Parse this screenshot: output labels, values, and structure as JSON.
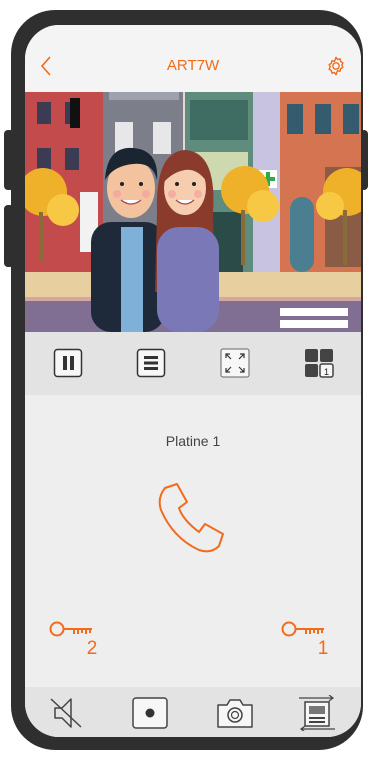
{
  "header": {
    "title": "ART7W",
    "back_icon": "chevron-left-icon",
    "settings_icon": "gear-icon"
  },
  "video": {
    "description_icons": [
      "city-street-icon",
      "couple-icon"
    ]
  },
  "controls": [
    {
      "name": "pause-button",
      "icon": "pause-icon"
    },
    {
      "name": "menu-button",
      "icon": "list-icon"
    },
    {
      "name": "fullscreen-button",
      "icon": "expand-icon"
    },
    {
      "name": "camera-switch-button",
      "icon": "grid-icon",
      "badge": "1"
    }
  ],
  "panel": {
    "name": "Platine 1"
  },
  "call": {
    "icon": "phone-icon"
  },
  "locks": [
    {
      "name": "lock-2",
      "icon": "key-icon",
      "number": "2"
    },
    {
      "name": "lock-1",
      "icon": "key-icon",
      "number": "1"
    }
  ],
  "bottom_bar": [
    {
      "name": "mute-button",
      "icon": "speaker-mute-icon"
    },
    {
      "name": "record-button",
      "icon": "record-icon"
    },
    {
      "name": "snapshot-button",
      "icon": "camera-icon"
    },
    {
      "name": "intercom-button",
      "icon": "intercom-icon"
    }
  ],
  "colors": {
    "accent": "#f26b1d",
    "frame": "#2f2f2f",
    "background": "#eeeeee"
  }
}
